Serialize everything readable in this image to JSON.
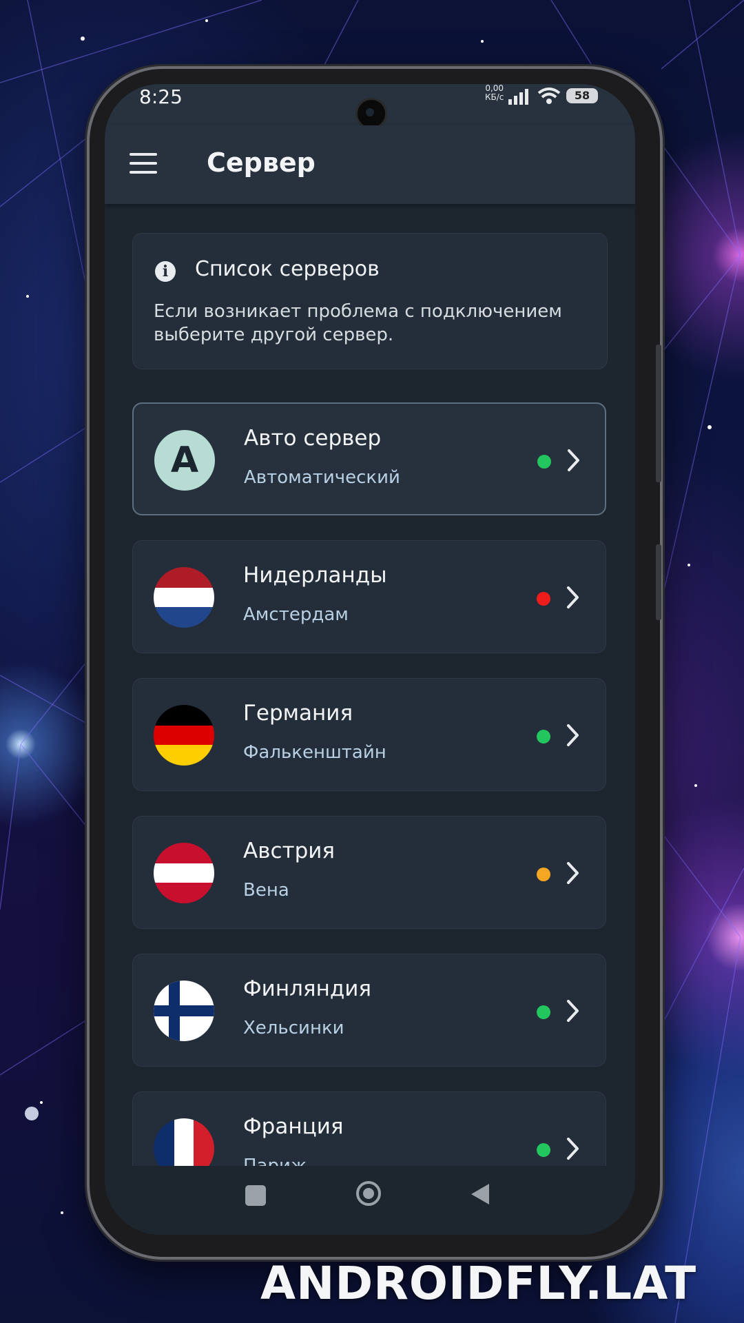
{
  "status_bar": {
    "time": "8:25",
    "net_speed_value": "0,00",
    "net_speed_unit": "КБ/с",
    "battery": "58"
  },
  "app_bar": {
    "title": "Сервер",
    "menu_icon": "hamburger-menu-icon"
  },
  "info_card": {
    "icon": "info-icon",
    "title": "Список серверов",
    "text": "Если возникает проблема с подключением выберите другой сервер."
  },
  "servers": [
    {
      "name": "Авто сервер",
      "city": "Автоматический",
      "avatar_letter": "A",
      "flag": "auto",
      "status": "online",
      "status_color": "#22c55e",
      "selected": true
    },
    {
      "name": "Нидерланды",
      "city": "Амстердам",
      "flag": "netherlands",
      "status": "offline",
      "status_color": "#ef1c1c",
      "selected": false
    },
    {
      "name": "Германия",
      "city": "Фалькенштайн",
      "flag": "germany",
      "status": "online",
      "status_color": "#22c55e",
      "selected": false
    },
    {
      "name": "Австрия",
      "city": "Вена",
      "flag": "austria",
      "status": "busy",
      "status_color": "#f5a623",
      "selected": false
    },
    {
      "name": "Финляндия",
      "city": "Хельсинки",
      "flag": "finland",
      "status": "online",
      "status_color": "#22c55e",
      "selected": false
    },
    {
      "name": "Франция",
      "city": "Париж",
      "flag": "france",
      "status": "online",
      "status_color": "#22c55e",
      "selected": false
    }
  ],
  "nav_bar": {
    "recent": "recent-apps-icon",
    "home": "home-icon",
    "back": "back-icon"
  },
  "watermark": "ANDROIDFLY.LAT",
  "colors": {
    "screen_bg": "#1d252f",
    "card_bg": "#242e3a",
    "app_bar_bg": "#27323e",
    "secondary_text": "#b9d0e4"
  }
}
